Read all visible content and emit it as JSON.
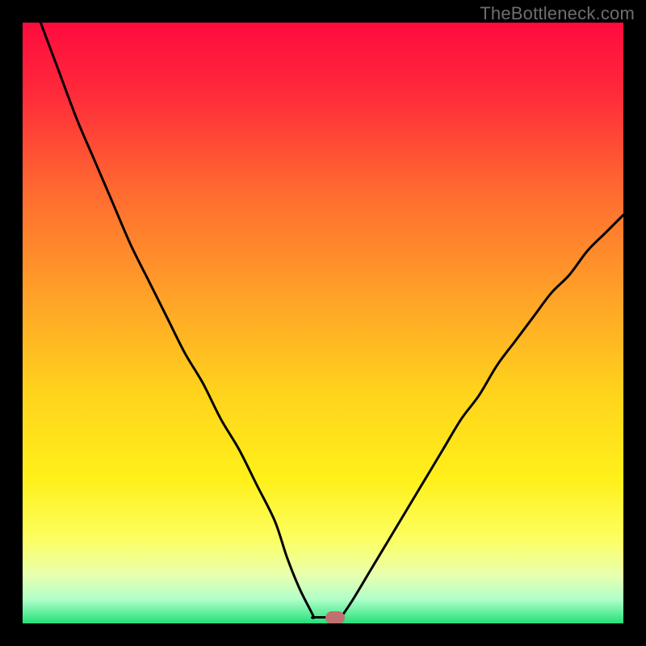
{
  "watermark": "TheBottleneck.com",
  "gradient": {
    "stops": [
      {
        "offset": "0%",
        "color": "#ff0b3e"
      },
      {
        "offset": "12%",
        "color": "#ff2b3a"
      },
      {
        "offset": "28%",
        "color": "#ff6a30"
      },
      {
        "offset": "45%",
        "color": "#ffa028"
      },
      {
        "offset": "62%",
        "color": "#ffd41c"
      },
      {
        "offset": "76%",
        "color": "#fff01a"
      },
      {
        "offset": "86%",
        "color": "#fcff62"
      },
      {
        "offset": "92%",
        "color": "#e8ffb0"
      },
      {
        "offset": "96%",
        "color": "#b0ffc8"
      },
      {
        "offset": "100%",
        "color": "#25e07a"
      }
    ]
  },
  "chart_data": {
    "type": "line",
    "title": "",
    "xlabel": "",
    "ylabel": "",
    "xlim": [
      0,
      100
    ],
    "ylim": [
      0,
      100
    ],
    "series": [
      {
        "name": "left-branch",
        "x": [
          3,
          6,
          9,
          12,
          15,
          18,
          21,
          24,
          27,
          30,
          33,
          36,
          39,
          42,
          44,
          46,
          48,
          48.5
        ],
        "y": [
          100,
          92,
          84,
          77,
          70,
          63,
          57,
          51,
          45,
          40,
          34,
          29,
          23,
          17,
          11,
          6,
          2,
          1
        ]
      },
      {
        "name": "valley-floor",
        "x": [
          48.5,
          53
        ],
        "y": [
          1,
          1
        ]
      },
      {
        "name": "right-branch",
        "x": [
          53,
          55,
          58,
          61,
          64,
          67,
          70,
          73,
          76,
          79,
          82,
          85,
          88,
          91,
          94,
          97,
          100
        ],
        "y": [
          1,
          4,
          9,
          14,
          19,
          24,
          29,
          34,
          38,
          43,
          47,
          51,
          55,
          58,
          62,
          65,
          68
        ]
      }
    ],
    "marker": {
      "x": 52,
      "y": 1
    },
    "background": "vertical-gradient-red-to-green"
  }
}
